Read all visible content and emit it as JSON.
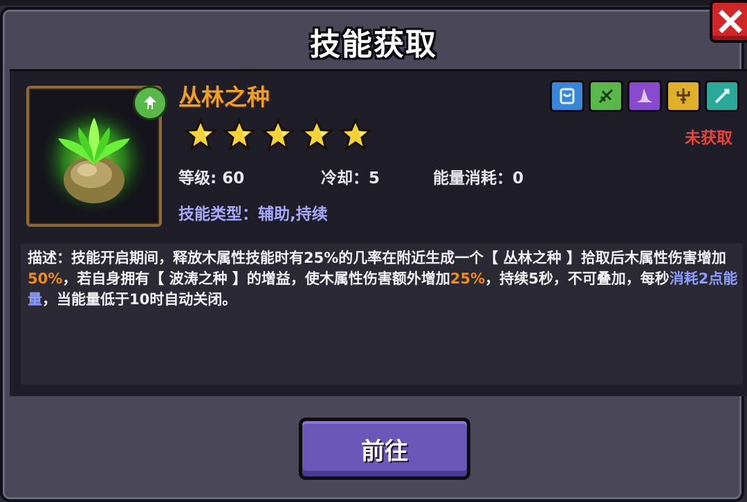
{
  "dialog": {
    "title": "技能获取",
    "close_icon": "close-icon"
  },
  "skill": {
    "name": "丛林之种",
    "icon": "jungle-seed-icon",
    "element_badge_icon": "wood-element-icon",
    "stars": 5,
    "level_label": "等级: 60",
    "cooldown_label": "冷却：5",
    "energy_label": "能量消耗：0",
    "type_label": "技能类型：",
    "type_value": "辅助,持续",
    "status": "未获取"
  },
  "attribute_icons": [
    {
      "name": "water-attribute-icon",
      "color": "#3a86d6"
    },
    {
      "name": "wood-attribute-icon",
      "color": "#5ab84a"
    },
    {
      "name": "shadow-attribute-icon",
      "color": "#8a4ad0"
    },
    {
      "name": "gold-attribute-icon",
      "color": "#e0b02a"
    },
    {
      "name": "wind-attribute-icon",
      "color": "#2aa898"
    }
  ],
  "description": {
    "seg1": "描述：技能开启期间，释放木属性技能时有25%的几率在附近生成一个【 丛林之种 】拾取后木属性伤害增加",
    "hl1": "50%",
    "seg2": "，若自身拥有【 波涛之种 】的增益，使木属性伤害额外增加",
    "hl2": "25%",
    "seg3": "，持续5秒，不可叠加，每秒",
    "hl3": "消耗2点能量",
    "seg4": "，当能量低于10时自动关闭。"
  },
  "buttons": {
    "go_label": "前往"
  },
  "colors": {
    "skill_name": "#f0a020",
    "status": "#e8423a",
    "highlight_orange": "#f08c1e",
    "highlight_blue": "#8c9cff",
    "button": "#6a58b8"
  }
}
